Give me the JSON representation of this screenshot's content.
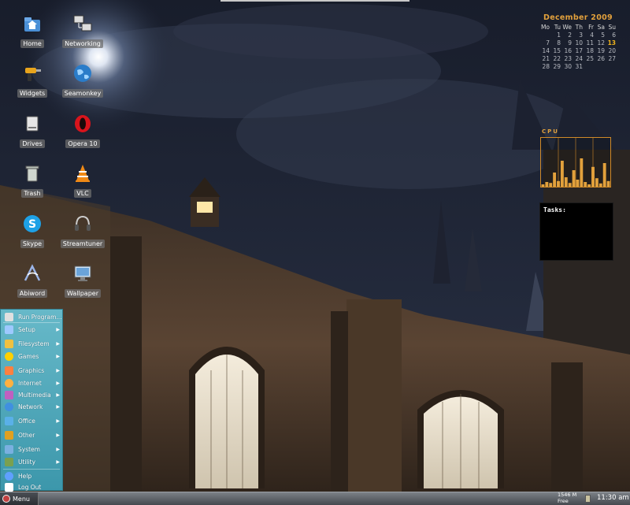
{
  "desktop_icons": [
    {
      "label": "Home",
      "icon": "home-folder-icon"
    },
    {
      "label": "Networking",
      "icon": "network-computers-icon"
    },
    {
      "label": "Widgets",
      "icon": "drill-tool-icon"
    },
    {
      "label": "Seamonkey",
      "icon": "globe-icon"
    },
    {
      "label": "Drives",
      "icon": "drive-icon"
    },
    {
      "label": "Opera 10",
      "icon": "opera-icon"
    },
    {
      "label": "Trash",
      "icon": "trash-icon"
    },
    {
      "label": "VLC",
      "icon": "vlc-cone-icon"
    },
    {
      "label": "Skype",
      "icon": "skype-icon"
    },
    {
      "label": "Streamtuner",
      "icon": "headphones-icon"
    },
    {
      "label": "Abiword",
      "icon": "abiword-icon"
    },
    {
      "label": "Wallpaper",
      "icon": "monitor-icon"
    }
  ],
  "calendar": {
    "title": "December 2009",
    "weekdays": [
      "Mo",
      "Tu",
      "We",
      "Th",
      "Fr",
      "Sa",
      "Su"
    ],
    "days": [
      "",
      "1",
      "2",
      "3",
      "4",
      "5",
      "6",
      "7",
      "8",
      "9",
      "10",
      "11",
      "12",
      "13",
      "14",
      "15",
      "16",
      "17",
      "18",
      "19",
      "20",
      "21",
      "22",
      "23",
      "24",
      "25",
      "26",
      "27",
      "28",
      "29",
      "30",
      "31",
      "",
      "",
      ""
    ],
    "today": "13"
  },
  "cpu_widget": {
    "label": "CPU",
    "load": [
      0.05,
      0.1,
      0.08,
      0.3,
      0.12,
      0.55,
      0.2,
      0.08,
      0.35,
      0.15,
      0.6,
      0.1,
      0.05,
      0.42,
      0.18,
      0.07,
      0.5,
      0.12
    ]
  },
  "tasks_widget": {
    "label": "Tasks:"
  },
  "start_menu": {
    "items": [
      {
        "label": "Run Program...",
        "icon": "run-program-icon",
        "submenu": false
      },
      {
        "label": "Setup",
        "icon": "setup-icon",
        "submenu": true
      },
      {
        "label": "Filesystem",
        "icon": "filesystem-icon",
        "submenu": true
      },
      {
        "label": "Games",
        "icon": "games-icon",
        "submenu": true
      },
      {
        "label": "Graphics",
        "icon": "graphics-icon",
        "submenu": true
      },
      {
        "label": "Internet",
        "icon": "internet-icon",
        "submenu": true
      },
      {
        "label": "Multimedia",
        "icon": "multimedia-icon",
        "submenu": true
      },
      {
        "label": "Network",
        "icon": "network-icon",
        "submenu": true
      },
      {
        "label": "Office",
        "icon": "office-icon",
        "submenu": true
      },
      {
        "label": "Other",
        "icon": "other-icon",
        "submenu": true
      },
      {
        "label": "System",
        "icon": "system-icon",
        "submenu": true
      },
      {
        "label": "Utility",
        "icon": "utility-icon",
        "submenu": true
      },
      {
        "label": "Help",
        "icon": "help-icon",
        "submenu": false
      },
      {
        "label": "Log Out",
        "icon": "logout-icon",
        "submenu": false
      }
    ]
  },
  "taskbar": {
    "menu_label": "Menu",
    "memory_line1": "1546 M",
    "memory_line2": "Free",
    "clock": "11:30 am"
  },
  "colors": {
    "accent": "#e2a13c",
    "menu_bg": "#4fa9bb",
    "taskbar": "#5a5e64"
  }
}
